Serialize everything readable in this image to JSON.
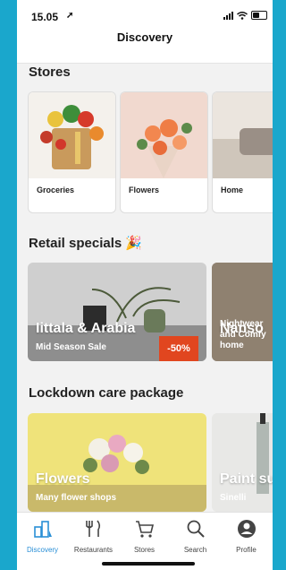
{
  "status": {
    "time": "15.05",
    "location_glyph": "➚"
  },
  "nav": {
    "title": "Discovery"
  },
  "sections": {
    "stores": {
      "title": "Stores",
      "items": [
        {
          "label": "Groceries"
        },
        {
          "label": "Flowers"
        },
        {
          "label": "Home"
        }
      ]
    },
    "retail": {
      "title": "Retail specials 🎉",
      "cards": [
        {
          "name": "Iittala & Arabia",
          "subtitle": "Mid Season Sale",
          "badge": "-50%"
        },
        {
          "name": "Nanso",
          "subtitle": "Nightwear and Comfy home"
        }
      ]
    },
    "lockdown": {
      "title": "Lockdown care package",
      "cards": [
        {
          "name": "Flowers",
          "subtitle": "Many flower shops"
        },
        {
          "name": "Paint sup",
          "subtitle": "Sinelli"
        }
      ]
    }
  },
  "tabs": [
    {
      "label": "Discovery",
      "icon": "discovery-icon",
      "active": true
    },
    {
      "label": "Restaurants",
      "icon": "fork-knife-icon"
    },
    {
      "label": "Stores",
      "icon": "cart-icon"
    },
    {
      "label": "Search",
      "icon": "search-icon"
    },
    {
      "label": "Profile",
      "icon": "profile-icon"
    }
  ],
  "colors": {
    "accent": "#2a8fd6",
    "badge": "#e1461f",
    "outer_bg": "#1aa7cc"
  }
}
